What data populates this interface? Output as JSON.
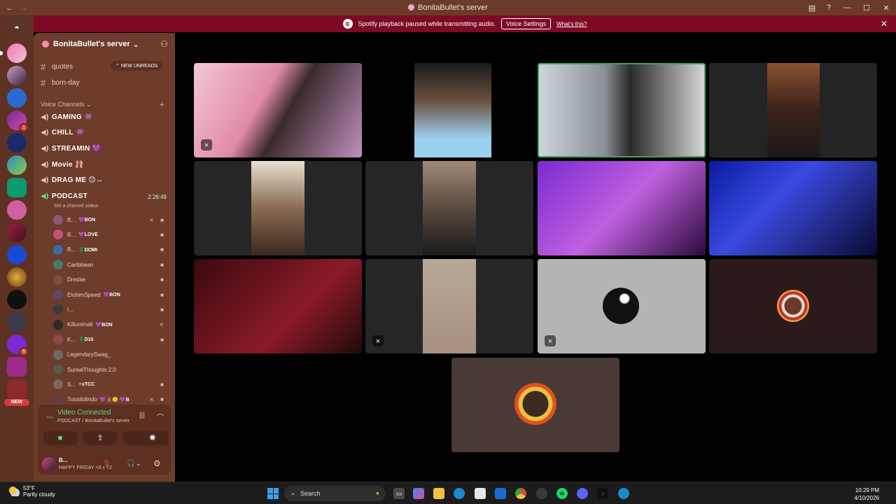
{
  "window": {
    "title": "BonitaBullet's server"
  },
  "banner": {
    "text": "Spotify playback paused while transmitting audio.",
    "button_label": "Voice Settings",
    "link_label": "What's this?"
  },
  "server": {
    "name": "BonitaBullet's server"
  },
  "channels": {
    "text": [
      {
        "name": "quotes"
      },
      {
        "name": "born-day"
      }
    ],
    "new_unreads_label": "NEW UNREADS",
    "voice_header": "Voice Channels",
    "voice": [
      {
        "name": "GAMING",
        "emoji": "👾"
      },
      {
        "name": "CHILL",
        "emoji": "👾"
      },
      {
        "name": "STREAMIN",
        "emoji": "💜"
      },
      {
        "name": "Movie",
        "emoji": "🩰"
      },
      {
        "name": "DRAG ME",
        "emoji": "🙃↔"
      }
    ],
    "podcast": {
      "name": "PODCAST",
      "timer": "2:26:49",
      "status": "Set a channel status"
    }
  },
  "voice_users": [
    {
      "name": "B...",
      "tag": "💜BON",
      "avatar_color": "#8a5a7a",
      "icons": [
        "mute-icon",
        "camera-icon"
      ]
    },
    {
      "name": "B...",
      "tag": "💜LOVE",
      "avatar_color": "#c4507a",
      "icons": [
        "camera-icon"
      ]
    },
    {
      "name": "B...",
      "tag": "💲DOMI",
      "avatar_color": "#3a6ab0",
      "icons": [
        "camera-icon"
      ]
    },
    {
      "name": "Caribbean",
      "tag": "",
      "avatar_color": "#4a7a6a",
      "icons": [
        "camera-icon"
      ]
    },
    {
      "name": "Dredae",
      "tag": "",
      "avatar_color": "#7a5040",
      "icons": [
        "camera-icon"
      ]
    },
    {
      "name": "ElohimSpeed",
      "tag": "💜BON",
      "avatar_color": "#5a4a6a",
      "icons": [
        "camera-icon"
      ]
    },
    {
      "name": "I...",
      "tag": "",
      "avatar_color": "#3a3a3a",
      "icons": [
        "camera-icon"
      ]
    },
    {
      "name": "Killuminati",
      "tag": "💜BON",
      "avatar_color": "#2a2a2a",
      "icons": [
        "mute-icon"
      ]
    },
    {
      "name": "K...",
      "tag": "💲D10",
      "avatar_color": "#8a4a4a",
      "icons": [
        "camera-icon"
      ]
    },
    {
      "name": "LegendarySwag_",
      "tag": "",
      "avatar_color": "#6a6a6a",
      "icons": []
    },
    {
      "name": "SurealThoughts 2.0",
      "tag": "",
      "avatar_color": "#5a5a4a",
      "icons": []
    },
    {
      "name": "S...",
      "tag": "⚡xTCC",
      "avatar_color": "#7a6a5a",
      "icons": [
        "camera-icon"
      ]
    },
    {
      "name": "Tuositolindo",
      "tag": "💜🧸🙂 💜B",
      "avatar_color": "#6a3a4a",
      "icons": [
        "mute-icon",
        "camera-icon"
      ]
    }
  ],
  "voice_panel": {
    "status": "Video Connected",
    "location": "PODCAST / BonitaBullet's server"
  },
  "user_bar": {
    "name": "B...",
    "status": "HAPPY FRIDAY <3 c +2"
  },
  "taskbar": {
    "weather_temp": "53°F",
    "weather_desc": "Partly cloudy",
    "search_label": "Search",
    "time": "10:29 PM",
    "date": "4/10/2026"
  },
  "server_list_badges": {
    "new_label": "NEW"
  },
  "colors": {
    "titlebar": "#6b3a2a",
    "banner": "#7d0a24",
    "speaking_outline": "#3ba55c",
    "connected_green": "#64d88e"
  }
}
